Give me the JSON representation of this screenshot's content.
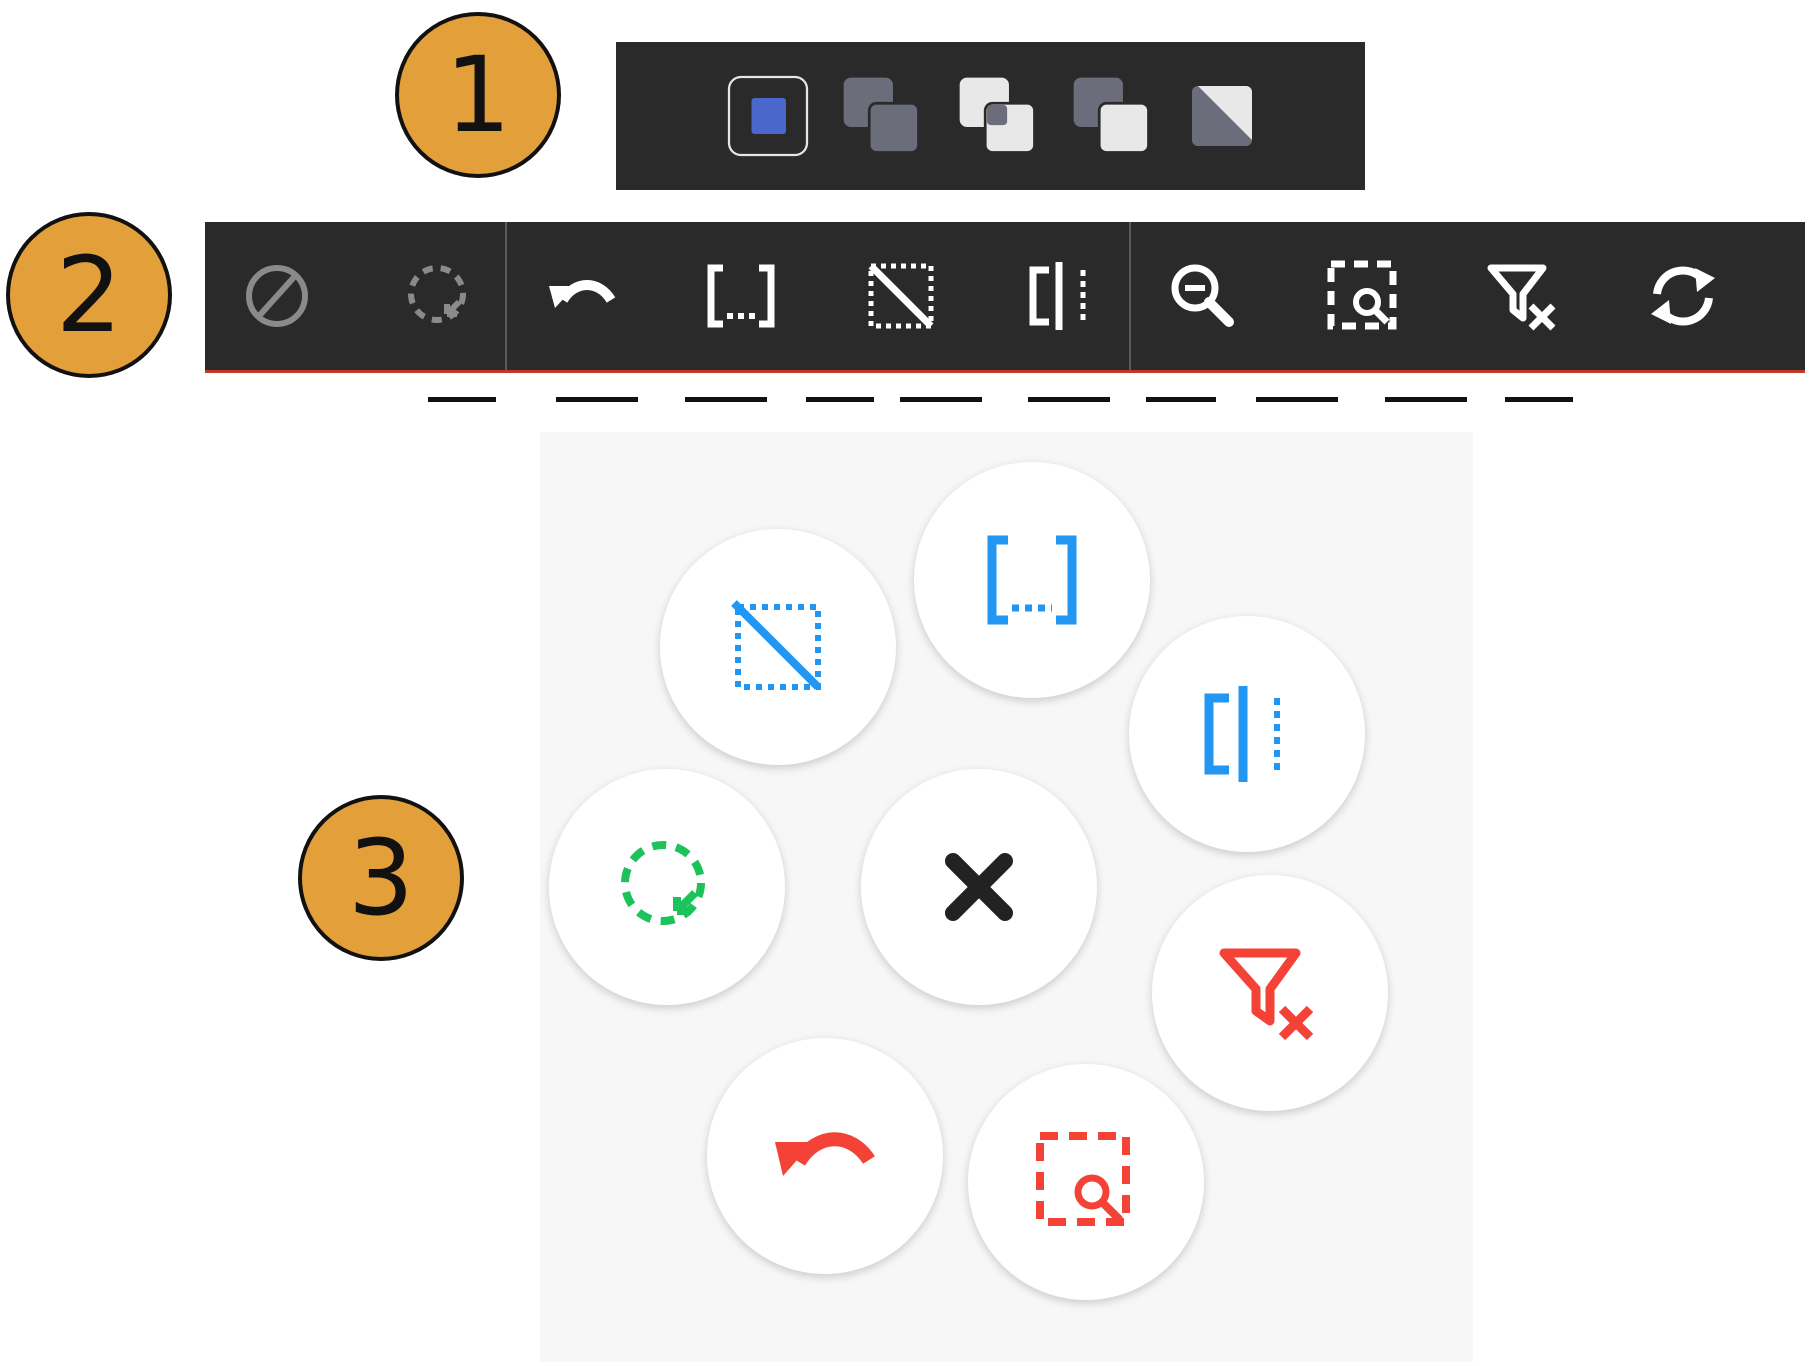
{
  "callouts": [
    "1",
    "2",
    "3"
  ],
  "blend_modes_bar": {
    "items": [
      {
        "icon": "new-selection-icon",
        "selected": true
      },
      {
        "icon": "union-selection-icon"
      },
      {
        "icon": "intersect-selection-icon"
      },
      {
        "icon": "subtract-selection-icon"
      },
      {
        "icon": "invert-selection-icon"
      }
    ],
    "colors": {
      "background": "#2a2a2a",
      "selected_fill": "#4a68cc",
      "shape": "#6b6e7a",
      "light_shape": "#e8e8e8"
    }
  },
  "toolbar": {
    "groups": [
      [
        "disable-icon",
        "lasso-select-icon"
      ],
      [
        "undo-icon",
        "brackets-icon",
        "clear-selection-icon",
        "split-icon"
      ],
      [
        "zoom-icon",
        "zoom-selection-icon",
        "clear-filter-icon",
        "refresh-icon"
      ]
    ],
    "colors": {
      "background": "#2a2a2a",
      "icon": "#ffffff",
      "disabled_icon": "#8a8a8a",
      "bottom_border": "#c0392b"
    }
  },
  "radial_menu": {
    "center": "close-icon",
    "items": [
      "clear-selection-icon",
      "brackets-icon",
      "split-icon",
      "lasso-select-icon",
      "clear-filter-icon",
      "undo-icon",
      "zoom-selection-icon"
    ],
    "colors": {
      "blue": "#2196f3",
      "green": "#1ec25a",
      "red": "#f44336",
      "dark": "#222222",
      "panel": "#f7f7f7"
    }
  }
}
